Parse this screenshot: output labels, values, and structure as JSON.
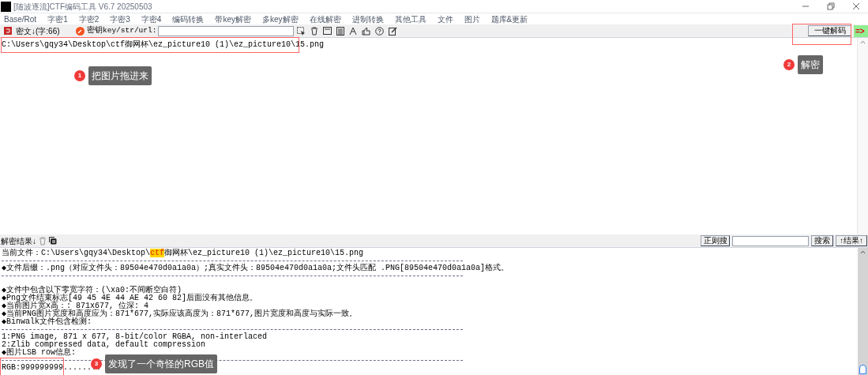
{
  "window": {
    "title": "[随波逐流]CTF编码工具 V6.7  20250503"
  },
  "menu": [
    "Base/Rot",
    "字密1",
    "字密2",
    "字密3",
    "字密4",
    "编码转换",
    "带key解密",
    "多key解密",
    "在线解密",
    "进制转换",
    "其他工具",
    "文件",
    "图片",
    "题库&更新"
  ],
  "toolbar": {
    "ciphertext_label": "密文↓(字:66)",
    "key_label": "密钥key/str/url:",
    "decode_button": "一键解码",
    "arrow": "=>"
  },
  "input_text": "C:\\Users\\gqy34\\Desktop\\ctf御网杯\\ez_picture10 (1)\\ez_picture10\\15.png",
  "result_bar": {
    "label": "解密结果↓",
    "regex_button": "正则搜",
    "search_button": "搜索",
    "result_button": "↑结果↑"
  },
  "result_lines": [
    {
      "kind": "file",
      "before": "当前文件：C:\\Users\\gqy34\\Desktop\\",
      "highlight": "ctf",
      "after": "御网杯\\ez_picture10 (1)\\ez_picture10\\15.png"
    },
    {
      "kind": "rule"
    },
    {
      "kind": "text",
      "text": "◆文件后缀：.png（对应文件头：89504e470d0a1a0a）;真实文件头：89504e470d0a1a0a;文件头匹配 .PNG[89504e470d0a1a0a]格式。"
    },
    {
      "kind": "rule"
    },
    {
      "kind": "blank"
    },
    {
      "kind": "text",
      "text": "◆文件中包含以下零宽字符：(\\xa0:不间断空白符)"
    },
    {
      "kind": "text",
      "text": "◆Png文件结束标志[49 45 4E 44 AE 42 60 82]后面没有其他信息。"
    },
    {
      "kind": "text",
      "text": "◆当前图片宽x高：: 871x677, 位深: 4"
    },
    {
      "kind": "text",
      "text": "◆当前PNG图片宽度和高度应为：871*677,实际应该高度为：871*677,图片宽度和高度与实际一致。"
    },
    {
      "kind": "text",
      "text": "◆Binwalk文件包含检测:"
    },
    {
      "kind": "rule"
    },
    {
      "kind": "text",
      "text": "1:PNG image, 871 x 677, 8-bit/color RGBA, non-interlaced"
    },
    {
      "kind": "text",
      "text": "2:Zlib compressed data, default compression"
    },
    {
      "kind": "text",
      "text": "◆图片LSB row信息:"
    },
    {
      "kind": "rule"
    },
    {
      "kind": "text",
      "text": "RGB:999999999........"
    }
  ],
  "callouts": [
    {
      "number": "1",
      "text": "把图片拖进来"
    },
    {
      "number": "2",
      "text": "解密"
    },
    {
      "number": "3",
      "text": "发现了一个奇怪的RGB值"
    }
  ]
}
